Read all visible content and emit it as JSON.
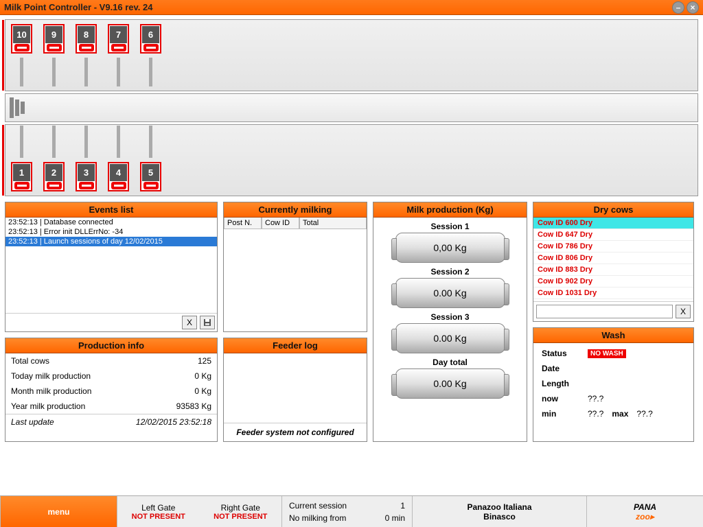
{
  "title": "Milk Point Controller - V9.16 rev. 24",
  "top_posts": [
    "10",
    "9",
    "8",
    "7",
    "6"
  ],
  "bottom_posts": [
    "1",
    "2",
    "3",
    "4",
    "5"
  ],
  "events": {
    "title": "Events list",
    "rows": [
      "23:52:13 | Database connected",
      "23:52:13 | Error init DLLErrNo: -34",
      "23:52:13 | Launch sessions of day 12/02/2015"
    ],
    "selected": 2
  },
  "prodinfo": {
    "title": "Production info",
    "rows": [
      {
        "label": "Total cows",
        "value": "125"
      },
      {
        "label": "Today milk production",
        "value": "0 Kg"
      },
      {
        "label": "Month milk production",
        "value": "0 Kg"
      },
      {
        "label": "Year milk production",
        "value": "93583 Kg"
      }
    ],
    "update_label": "Last update",
    "update_value": "12/02/2015 23:52:18"
  },
  "currmilk": {
    "title": "Currently milking",
    "cols": [
      "Post N.",
      "Cow ID",
      "Total"
    ]
  },
  "feeder": {
    "title": "Feeder log",
    "empty": "Feeder system not configured"
  },
  "milkprod": {
    "title": "Milk production (Kg)",
    "sessions": [
      {
        "label": "Session 1",
        "value": "0,00 Kg"
      },
      {
        "label": "Session 2",
        "value": "0.00 Kg"
      },
      {
        "label": "Session 3",
        "value": "0.00 Kg"
      },
      {
        "label": "Day total",
        "value": "0.00 Kg"
      }
    ]
  },
  "drycows": {
    "title": "Dry cows",
    "rows": [
      "Cow ID 600 Dry",
      "Cow ID 647 Dry",
      "Cow ID 786 Dry",
      "Cow ID 806 Dry",
      "Cow ID 883 Dry",
      "Cow ID 902 Dry",
      "Cow ID 1031 Dry"
    ],
    "selected": 0,
    "clear": "X"
  },
  "wash": {
    "title": "Wash",
    "status_label": "Status",
    "status_value": "NO WASH",
    "date_label": "Date",
    "date_value": "",
    "length_label": "Length",
    "length_value": "",
    "now_label": "now",
    "now_value": "??.?",
    "min_label": "min",
    "min_value": "??.?",
    "max_label": "max",
    "max_value": "??.?"
  },
  "footer": {
    "menu": "menu",
    "left_gate": "Left Gate",
    "left_gate_status": "NOT PRESENT",
    "right_gate": "Right Gate",
    "right_gate_status": "NOT PRESENT",
    "curr_sess_label": "Current session",
    "curr_sess_value": "1",
    "nomilk_label": "No milking from",
    "nomilk_value": "0 min",
    "company1": "Panazoo Italiana",
    "company2": "Binasco",
    "logo": "PANAzoo"
  }
}
